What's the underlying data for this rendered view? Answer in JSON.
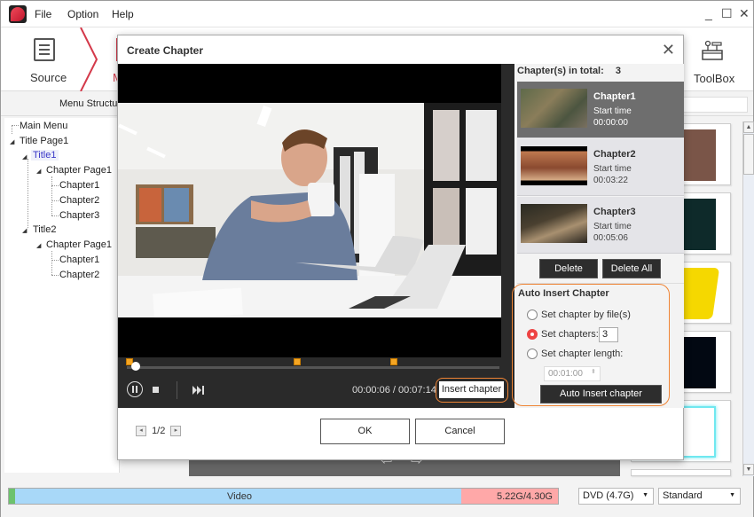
{
  "app": {
    "menu": [
      "File",
      "Option",
      "Help"
    ],
    "window_controls": {
      "minimize": "_",
      "maximize": "☐",
      "close": "✕"
    },
    "toolbar": {
      "source_label": "Source",
      "menu_partial_label": "M",
      "toolbox_label": "ToolBox"
    },
    "subbar": {
      "menu_structure_label": "Menu Structure"
    },
    "tree": [
      {
        "label": "Main Menu",
        "level": 0
      },
      {
        "label": "Title Page1",
        "level": 0
      },
      {
        "label": "Title1",
        "level": 1,
        "selected": true
      },
      {
        "label": "Chapter Page1",
        "level": 2
      },
      {
        "label": "Chapter1",
        "level": 3
      },
      {
        "label": "Chapter2",
        "level": 3
      },
      {
        "label": "Chapter3",
        "level": 3
      },
      {
        "label": "Title2",
        "level": 1
      },
      {
        "label": "Chapter Page1",
        "level": 2
      },
      {
        "label": "Chapter1",
        "level": 3
      },
      {
        "label": "Chapter2",
        "level": 3
      }
    ],
    "nav_arrows": {
      "left": "⇦",
      "right": "⇨"
    },
    "templates": [
      {
        "color": "#7a5548"
      },
      {
        "color": "#0e2a2a"
      },
      {
        "color": "#f5d800"
      },
      {
        "color": "#020812"
      },
      {
        "color": "#6fe8f0"
      }
    ],
    "status": {
      "capacity_label": "Video",
      "capacity_size": "5.22G/4.30G",
      "disc_type": "DVD (4.7G)",
      "quality": "Standard"
    },
    "colors": {
      "accent": "#ef8434",
      "brand": "#d4394a",
      "radio_on": "#ee4444"
    }
  },
  "dialog": {
    "title": "Create Chapter",
    "close_icon": "✕",
    "player": {
      "time_readout": "00:00:06 / 00:07:14",
      "insert_chapter_label": "Insert chapter",
      "progress_fraction": 0.014,
      "chapter_markers": [
        0.0,
        0.45,
        0.71
      ]
    },
    "pager": {
      "text": "1/2",
      "prev": "◂",
      "next": "▸"
    },
    "ok_label": "OK",
    "cancel_label": "Cancel",
    "chapters_header": "Chapter(s) in total:",
    "chapters_total": "3",
    "chapters": [
      {
        "name": "Chapter1",
        "start_label": "Start time",
        "start": "00:00:00",
        "active": true
      },
      {
        "name": "Chapter2",
        "start_label": "Start time",
        "start": "00:03:22",
        "active": false
      },
      {
        "name": "Chapter3",
        "start_label": "Start time",
        "start": "00:05:06",
        "active": false
      }
    ],
    "delete_label": "Delete",
    "delete_all_label": "Delete All",
    "auto": {
      "title": "Auto Insert Chapter",
      "option_by_file": "Set chapter by file(s)",
      "option_set_chapters": "Set chapters:",
      "set_chapters_value": "3",
      "option_length": "Set chapter length:",
      "length_value": "00:01:00",
      "selected_option": "set_chapters",
      "button_label": "Auto Insert chapter"
    }
  }
}
